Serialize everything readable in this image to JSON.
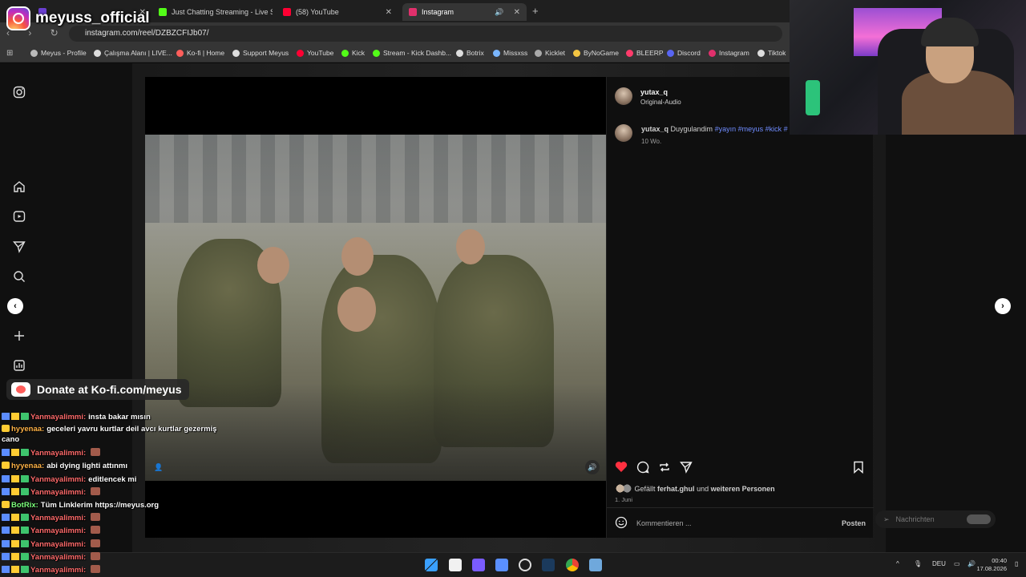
{
  "overlay": {
    "channel_name": "meyuss_official",
    "kofi_text": "Donate at Ko-fi.com/meyus"
  },
  "browser": {
    "tabs": [
      {
        "label": "",
        "active": false
      },
      {
        "label": "Just Chatting Streaming - Live S",
        "active": false
      },
      {
        "label": "(58) YouTube",
        "active": false
      },
      {
        "label": "Instagram",
        "active": true
      }
    ],
    "url": "instagram.com/reel/DZBZCFIJb07/",
    "bookmarks": [
      "Meyus - Profile",
      "Çalışma Alanı | LIVE...",
      "Ko-fi | Home",
      "Support Meyus",
      "YouTube",
      "Kick",
      "Stream - Kick Dashb...",
      "Botrix",
      "Missxss",
      "Kicklet",
      "ByNoGame",
      "BLEERP",
      "Discord",
      "Instagram",
      "Tiktok"
    ]
  },
  "post": {
    "author": "yutax_q",
    "audio": "Original-Audio",
    "caption_user": "yutax_q",
    "caption_text": "Duygulandim",
    "hashtags": "#yayın #meyus #kick #",
    "caption_age": "10 Wo.",
    "likes_prefix": "Gefällt",
    "likes_user": "ferhat.ghul",
    "likes_and": "und",
    "likes_others": "weiteren Personen",
    "date": "1. Juni",
    "comment_placeholder": "Kommentieren ...",
    "post_button": "Posten"
  },
  "messages_label": "Nachrichten",
  "chat": [
    {
      "nick": "Yanmayalimmi:",
      "msg": "insta bakar mısın",
      "nick_color": "#ff6b6b",
      "badges": true
    },
    {
      "nick": "hyyenaa:",
      "msg": "geceleri yavru kurtlar deil avcı kurtlar gezermiş cano",
      "nick_color": "#ffb347",
      "badges": false
    },
    {
      "nick": "Yanmayalimmi:",
      "msg": "",
      "nick_color": "#ff6b6b",
      "badges": true
    },
    {
      "nick": "hyyenaa:",
      "msg": "abi dying lighti attınmı",
      "nick_color": "#ffb347",
      "badges": false
    },
    {
      "nick": "Yanmayalimmi:",
      "msg": "editlencek mi",
      "nick_color": "#ff6b6b",
      "badges": true
    },
    {
      "nick": "Yanmayalimmi:",
      "msg": "",
      "nick_color": "#ff6b6b",
      "badges": true
    },
    {
      "nick": "BotRix:",
      "msg": "Tüm Linklerim https://meyus.org",
      "nick_color": "#7cff7c",
      "badges": false
    },
    {
      "nick": "Yanmayalimmi:",
      "msg": "",
      "nick_color": "#ff6b6b",
      "badges": true
    },
    {
      "nick": "Yanmayalimmi:",
      "msg": "",
      "nick_color": "#ff6b6b",
      "badges": true
    },
    {
      "nick": "Yanmayalimmi:",
      "msg": "",
      "nick_color": "#ff6b6b",
      "badges": true
    },
    {
      "nick": "Yanmayalimmi:",
      "msg": "",
      "nick_color": "#ff6b6b",
      "badges": true
    },
    {
      "nick": "Yanmayalimmi:",
      "msg": "",
      "nick_color": "#ff6b6b",
      "badges": true
    }
  ],
  "taskbar": {
    "language": "DEU",
    "time": "00:40",
    "date": "17.08.2026"
  },
  "colors": {
    "like_red": "#ff3040",
    "hashtag_blue": "#6f8cff"
  }
}
